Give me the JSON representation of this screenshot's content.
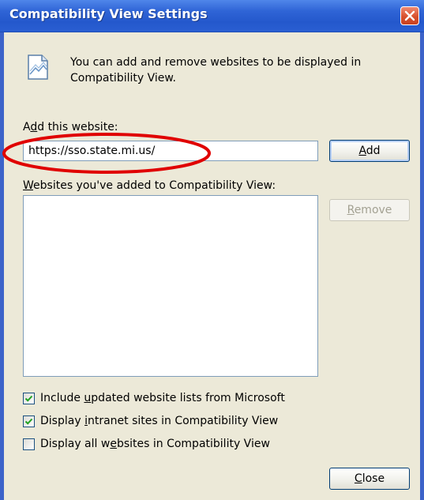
{
  "window": {
    "title": "Compatibility View Settings"
  },
  "info": {
    "text": "You can add and remove websites to be displayed in Compatibility View."
  },
  "add_section": {
    "label_pre": "A",
    "label_ul": "d",
    "label_post": "d this website:",
    "input_value": "https://sso.state.mi.us/",
    "add_button": {
      "pre": "",
      "ul": "A",
      "post": "dd"
    }
  },
  "list_section": {
    "label_pre": "",
    "label_ul": "W",
    "label_post": "ebsites you've added to Compatibility View:",
    "remove_button": {
      "pre": "",
      "ul": "R",
      "post": "emove"
    },
    "items": []
  },
  "options": [
    {
      "pre": "Include ",
      "ul": "u",
      "post": "pdated website lists from Microsoft",
      "checked": true
    },
    {
      "pre": "Display ",
      "ul": "i",
      "post": "ntranet sites in Compatibility View",
      "checked": true
    },
    {
      "pre": "Display all w",
      "ul": "e",
      "post": "bsites in Compatibility View",
      "checked": false
    }
  ],
  "close_button": {
    "pre": "",
    "ul": "C",
    "post": "lose"
  },
  "colors": {
    "titlebar": "#2458cc",
    "dialog_bg": "#ece9d8",
    "annotation": "#e00000"
  }
}
